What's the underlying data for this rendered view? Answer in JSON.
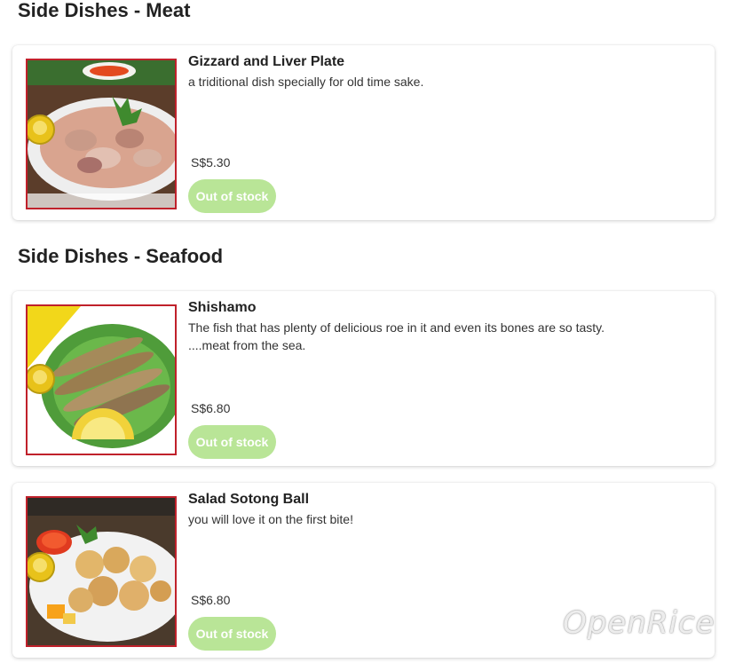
{
  "sections": [
    {
      "title": "Side Dishes - Meat",
      "items": [
        {
          "name": "Gizzard and Liver Plate",
          "description": "a triditional dish specially for old time sake.",
          "price": "S$5.30",
          "status": "Out of stock",
          "image_icon": "gizzard-liver-plate-image"
        }
      ]
    },
    {
      "title": "Side Dishes - Seafood",
      "items": [
        {
          "name": "Shishamo",
          "description_line1": "The fish that has plenty of delicious roe in it and even its bones are so tasty.",
          "description_line2": "....meat from the sea.",
          "price": "S$6.80",
          "status": "Out of stock",
          "image_icon": "shishamo-image"
        },
        {
          "name": "Salad Sotong Ball",
          "description": "you will love it on the first bite!",
          "price": "S$6.80",
          "status": "Out of stock",
          "image_icon": "sotong-ball-image"
        }
      ]
    }
  ],
  "watermark": "OpenRice",
  "colors": {
    "out_of_stock_button": "#b9e597",
    "image_border": "#c0212b",
    "badge": "#e8c21a"
  }
}
